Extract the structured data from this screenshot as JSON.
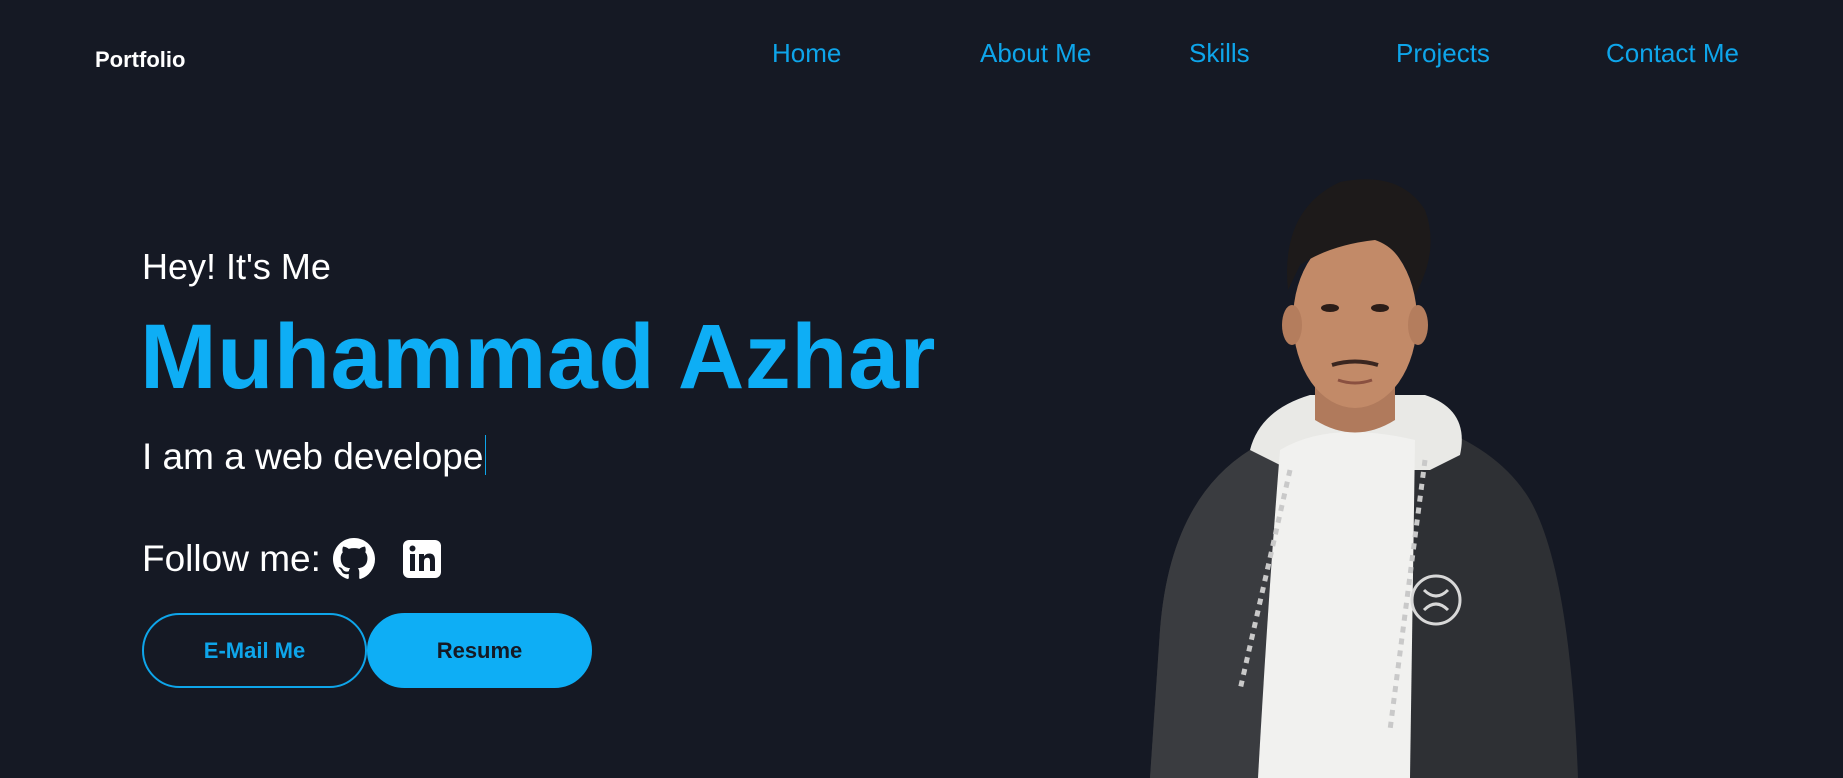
{
  "header": {
    "logo": "Portfolio",
    "nav": [
      "Home",
      "About Me",
      "Skills",
      "Projects",
      "Contact Me"
    ]
  },
  "hero": {
    "greeting": "Hey! It's Me",
    "name": "Muhammad Azhar",
    "role_text": "I am a web develope",
    "follow_label": "Follow me:",
    "social_icons": [
      "github-icon",
      "linkedin-icon"
    ],
    "buttons": {
      "email": "E-Mail Me",
      "resume": "Resume"
    }
  },
  "colors": {
    "background": "#151924",
    "accent": "#0eaef5",
    "text": "#ffffff"
  }
}
